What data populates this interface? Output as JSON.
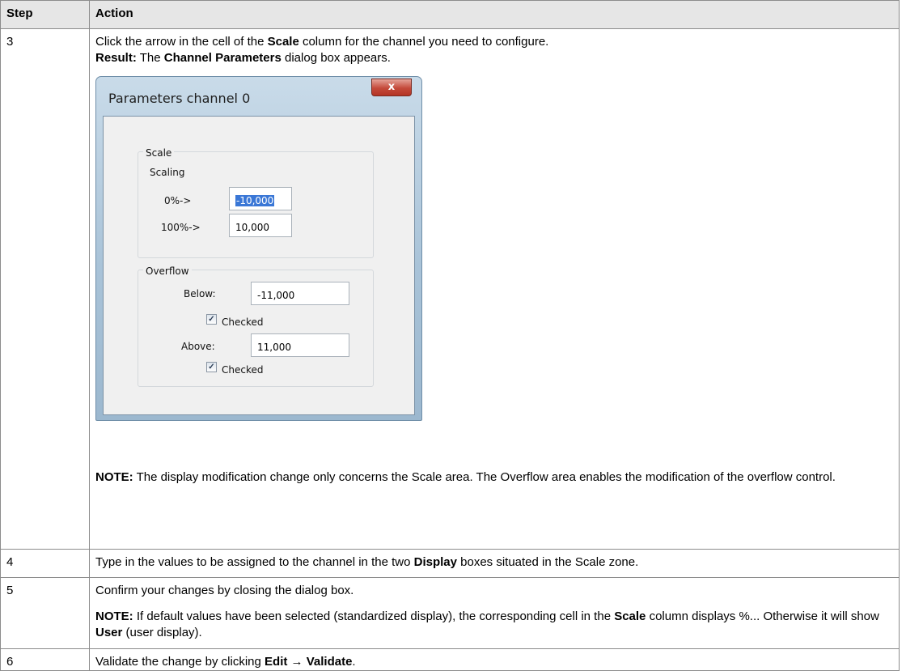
{
  "header": {
    "step": "Step",
    "action": "Action"
  },
  "row3": {
    "step": "3",
    "line1_a": "Click the arrow in the cell of the ",
    "line1_b": "Scale",
    "line1_c": " column for the channel you need to configure.",
    "result_label": "Result:",
    "result_a": " The ",
    "result_b": "Channel Parameters",
    "result_c": " dialog box appears.",
    "note_label": "NOTE:",
    "note_text": " The display modification change only concerns the Scale area. The Overflow area enables the modification of the overflow control."
  },
  "dialog": {
    "title": "Parameters channel 0",
    "close": "x",
    "scale_group": "Scale",
    "scaling": "Scaling",
    "zero_label": "0%->",
    "zero_value": "-10,000",
    "hundred_label": "100%->",
    "hundred_value": "10,000",
    "overflow_group": "Overflow",
    "below_label": "Below:",
    "below_value": "-11,000",
    "below_checked": "Checked",
    "above_label": "Above:",
    "above_value": "11,000",
    "above_checked": "Checked",
    "check_mark": "✓"
  },
  "row4": {
    "step": "4",
    "a": "Type in the values to be assigned to the channel in the two ",
    "b": "Display",
    "c": " boxes situated in the Scale zone."
  },
  "row5": {
    "step": "5",
    "line1": "Confirm your changes by closing the dialog box.",
    "note_label": "NOTE:",
    "note_a": " If default values have been selected (standardized display), the corresponding cell in the ",
    "note_b": "Scale",
    "note_c": " column displays %... Otherwise it will show ",
    "note_d": "User",
    "note_e": " (user display)."
  },
  "row6": {
    "step": "6",
    "a": "Validate the change by clicking ",
    "b": "Edit",
    "arrow": " → ",
    "c": "Validate",
    "d": "."
  }
}
